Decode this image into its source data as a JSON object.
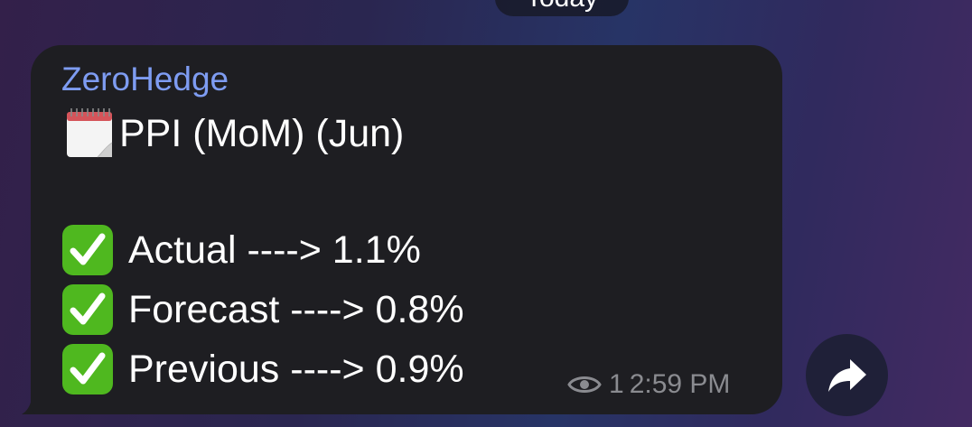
{
  "date_pill": {
    "label": "Today"
  },
  "message": {
    "sender": "ZeroHedge",
    "title": "PPI (MoM) (Jun)",
    "lines": [
      {
        "label": "Actual ----> 1.1%"
      },
      {
        "label": "Forecast ----> 0.8%"
      },
      {
        "label": "Previous ----> 0.9%"
      }
    ],
    "views": "1",
    "time": "2:59 PM"
  },
  "icons": {
    "calendar": "calendar-icon",
    "check": "check-mark-icon",
    "eye": "eye-icon",
    "share": "share-arrow-icon"
  },
  "colors": {
    "bubble": "#1e1e22",
    "sender": "#7e9cf2",
    "check_green": "#4fb81f",
    "meta": "#8a8b90"
  }
}
